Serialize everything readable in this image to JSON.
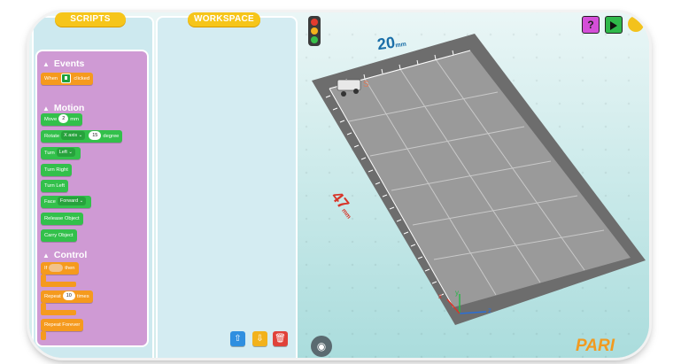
{
  "tabs": {
    "scripts": "SCRIPTS",
    "workspace": "WORKSPACE"
  },
  "palette": {
    "events": {
      "title": "Events",
      "when_clicked": {
        "prefix": "When",
        "suffix": "clicked"
      }
    },
    "motion": {
      "title": "Motion",
      "move": {
        "label": "Move",
        "value": "2",
        "unit": "mm"
      },
      "rotate": {
        "label": "Rotate",
        "axis": "X axis",
        "value": "15",
        "unit": "degree"
      },
      "turn": {
        "label": "Turn",
        "option": "Left"
      },
      "turn_right": "Turn Right",
      "turn_left": "Turn Left",
      "face": {
        "label": "Face",
        "option": "Forward"
      },
      "release_object": "Release Object",
      "carry_object": "Carry Object"
    },
    "control": {
      "title": "Control",
      "if_then": {
        "if": "If",
        "then": "then"
      },
      "repeat": {
        "label": "Repeat",
        "value": "10",
        "unit": "times"
      },
      "repeat_forever": "Repeat Forever"
    }
  },
  "scene": {
    "width_label": "20",
    "width_unit": "mm",
    "height_label": "47",
    "height_unit": "mm",
    "axis_x": "x",
    "axis_y": "y",
    "axis_z": "z"
  },
  "toolbar": {
    "help_label": "?",
    "brand": "PARI"
  },
  "colors": {
    "panel_bg": "#cde9ef",
    "palette_bg": "#cf9ad4",
    "tab": "#f6c51a",
    "motion_block": "#33c04b",
    "control_block": "#f59a1e"
  }
}
